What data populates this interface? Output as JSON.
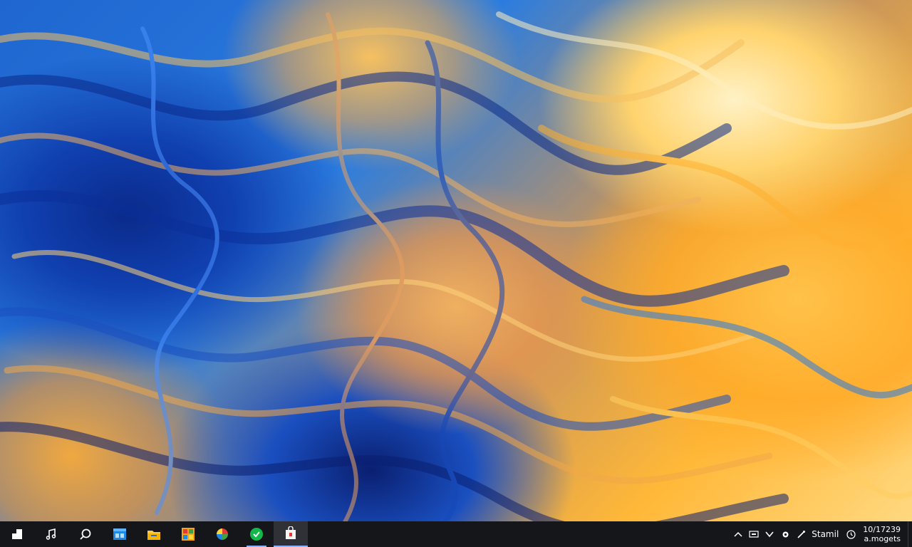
{
  "desktop": {
    "wallpaper": "abstract blue and orange marbled swirl",
    "colors": {
      "deep_blue": "#0a2a8a",
      "blue": "#1f66d0",
      "orange": "#ffb838",
      "cream": "#fff2c6"
    }
  },
  "taskbar": {
    "background": "#15161a",
    "start": {
      "icon": "windows-start-icon"
    },
    "pinned": [
      {
        "name": "music-note-icon",
        "state": "normal"
      },
      {
        "name": "search-icon",
        "state": "normal"
      },
      {
        "name": "blue-window-app-icon",
        "state": "normal"
      },
      {
        "name": "file-explorer-icon",
        "state": "normal"
      },
      {
        "name": "store-grid-app-icon",
        "state": "normal"
      },
      {
        "name": "multicolor-app-icon",
        "state": "normal"
      },
      {
        "name": "green-chat-app-icon",
        "state": "running"
      },
      {
        "name": "store-bag-icon",
        "state": "active"
      }
    ],
    "tray": {
      "icons": [
        "chevron-up-icon",
        "keyboard-icon",
        "check-icon",
        "gear-icon",
        "pen-icon"
      ],
      "label": "Stamil",
      "clock_icon": "clock-icon",
      "time": "10/17239",
      "date": "a.mogets"
    }
  }
}
